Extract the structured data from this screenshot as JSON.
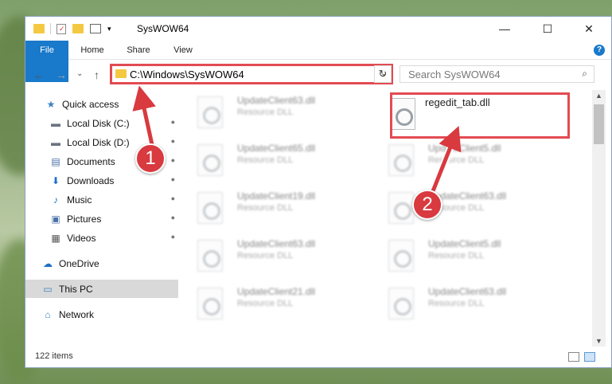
{
  "window": {
    "title": "SysWOW64",
    "minimize_glyph": "—",
    "maximize_glyph": "☐",
    "close_glyph": "✕"
  },
  "ribbon": {
    "tabs": [
      "File",
      "Home",
      "Share",
      "View"
    ],
    "help_glyph": "?"
  },
  "navbar": {
    "back_glyph": "←",
    "forward_glyph": "→",
    "recent_glyph": "⌄",
    "up_glyph": "↑",
    "address": "C:\\Windows\\SysWOW64",
    "address_dropdown_glyph": "⌄",
    "refresh_glyph": "↻",
    "search_placeholder": "Search SysWOW64",
    "search_glyph": "⌕"
  },
  "sidebar": {
    "items": [
      {
        "label": "Quick access",
        "icon": "star-icon",
        "glyph": "★",
        "color": "#3b82c4",
        "pinned": false
      },
      {
        "label": "Local Disk (C:)",
        "icon": "drive-icon",
        "glyph": "▬",
        "color": "#6b7280",
        "pinned": true
      },
      {
        "label": "Local Disk (D:)",
        "icon": "drive-icon",
        "glyph": "▬",
        "color": "#6b7280",
        "pinned": true
      },
      {
        "label": "Documents",
        "icon": "documents-icon",
        "glyph": "▤",
        "color": "#4a6fa5",
        "pinned": true
      },
      {
        "label": "Downloads",
        "icon": "download-icon",
        "glyph": "⬇",
        "color": "#1e6fc8",
        "pinned": true
      },
      {
        "label": "Music",
        "icon": "music-icon",
        "glyph": "♪",
        "color": "#1e6fc8",
        "pinned": true
      },
      {
        "label": "Pictures",
        "icon": "pictures-icon",
        "glyph": "▣",
        "color": "#4a6fa5",
        "pinned": true
      },
      {
        "label": "Videos",
        "icon": "videos-icon",
        "glyph": "▦",
        "color": "#555",
        "pinned": true
      },
      {
        "label": "OneDrive",
        "icon": "cloud-icon",
        "glyph": "☁",
        "color": "#1e6fc8",
        "pinned": false
      },
      {
        "label": "This PC",
        "icon": "computer-icon",
        "glyph": "▭",
        "color": "#3b82c4",
        "pinned": false,
        "selected": true
      },
      {
        "label": "Network",
        "icon": "network-icon",
        "glyph": "⌂",
        "color": "#3b82c4",
        "pinned": false
      }
    ],
    "pin_glyph": "📌"
  },
  "files": [
    {
      "name": "UpdateClient63.dll",
      "type": "Resource DLL",
      "blurred": true
    },
    {
      "name": "regedit_tab.dll",
      "type": "",
      "blurred": false
    },
    {
      "name": "UpdateClient65.dll",
      "type": "Resource DLL",
      "blurred": true
    },
    {
      "name": "UpdateClient5.dll",
      "type": "Resource DLL",
      "blurred": true
    },
    {
      "name": "UpdateClient19.dll",
      "type": "Resource DLL",
      "blurred": true
    },
    {
      "name": "UpdateClient63.dll",
      "type": "Resource DLL",
      "blurred": true
    },
    {
      "name": "UpdateClient63.dll",
      "type": "Resource DLL",
      "blurred": true
    },
    {
      "name": "UpdateClient5.dll",
      "type": "Resource DLL",
      "blurred": true
    },
    {
      "name": "UpdateClient21.dll",
      "type": "Resource DLL",
      "blurred": true
    },
    {
      "name": "UpdateClient63.dll",
      "type": "Resource DLL",
      "blurred": true
    }
  ],
  "status": {
    "items_count": "122 items"
  },
  "annotations": {
    "step1": "1",
    "step2": "2",
    "color": "#d83a3f"
  }
}
